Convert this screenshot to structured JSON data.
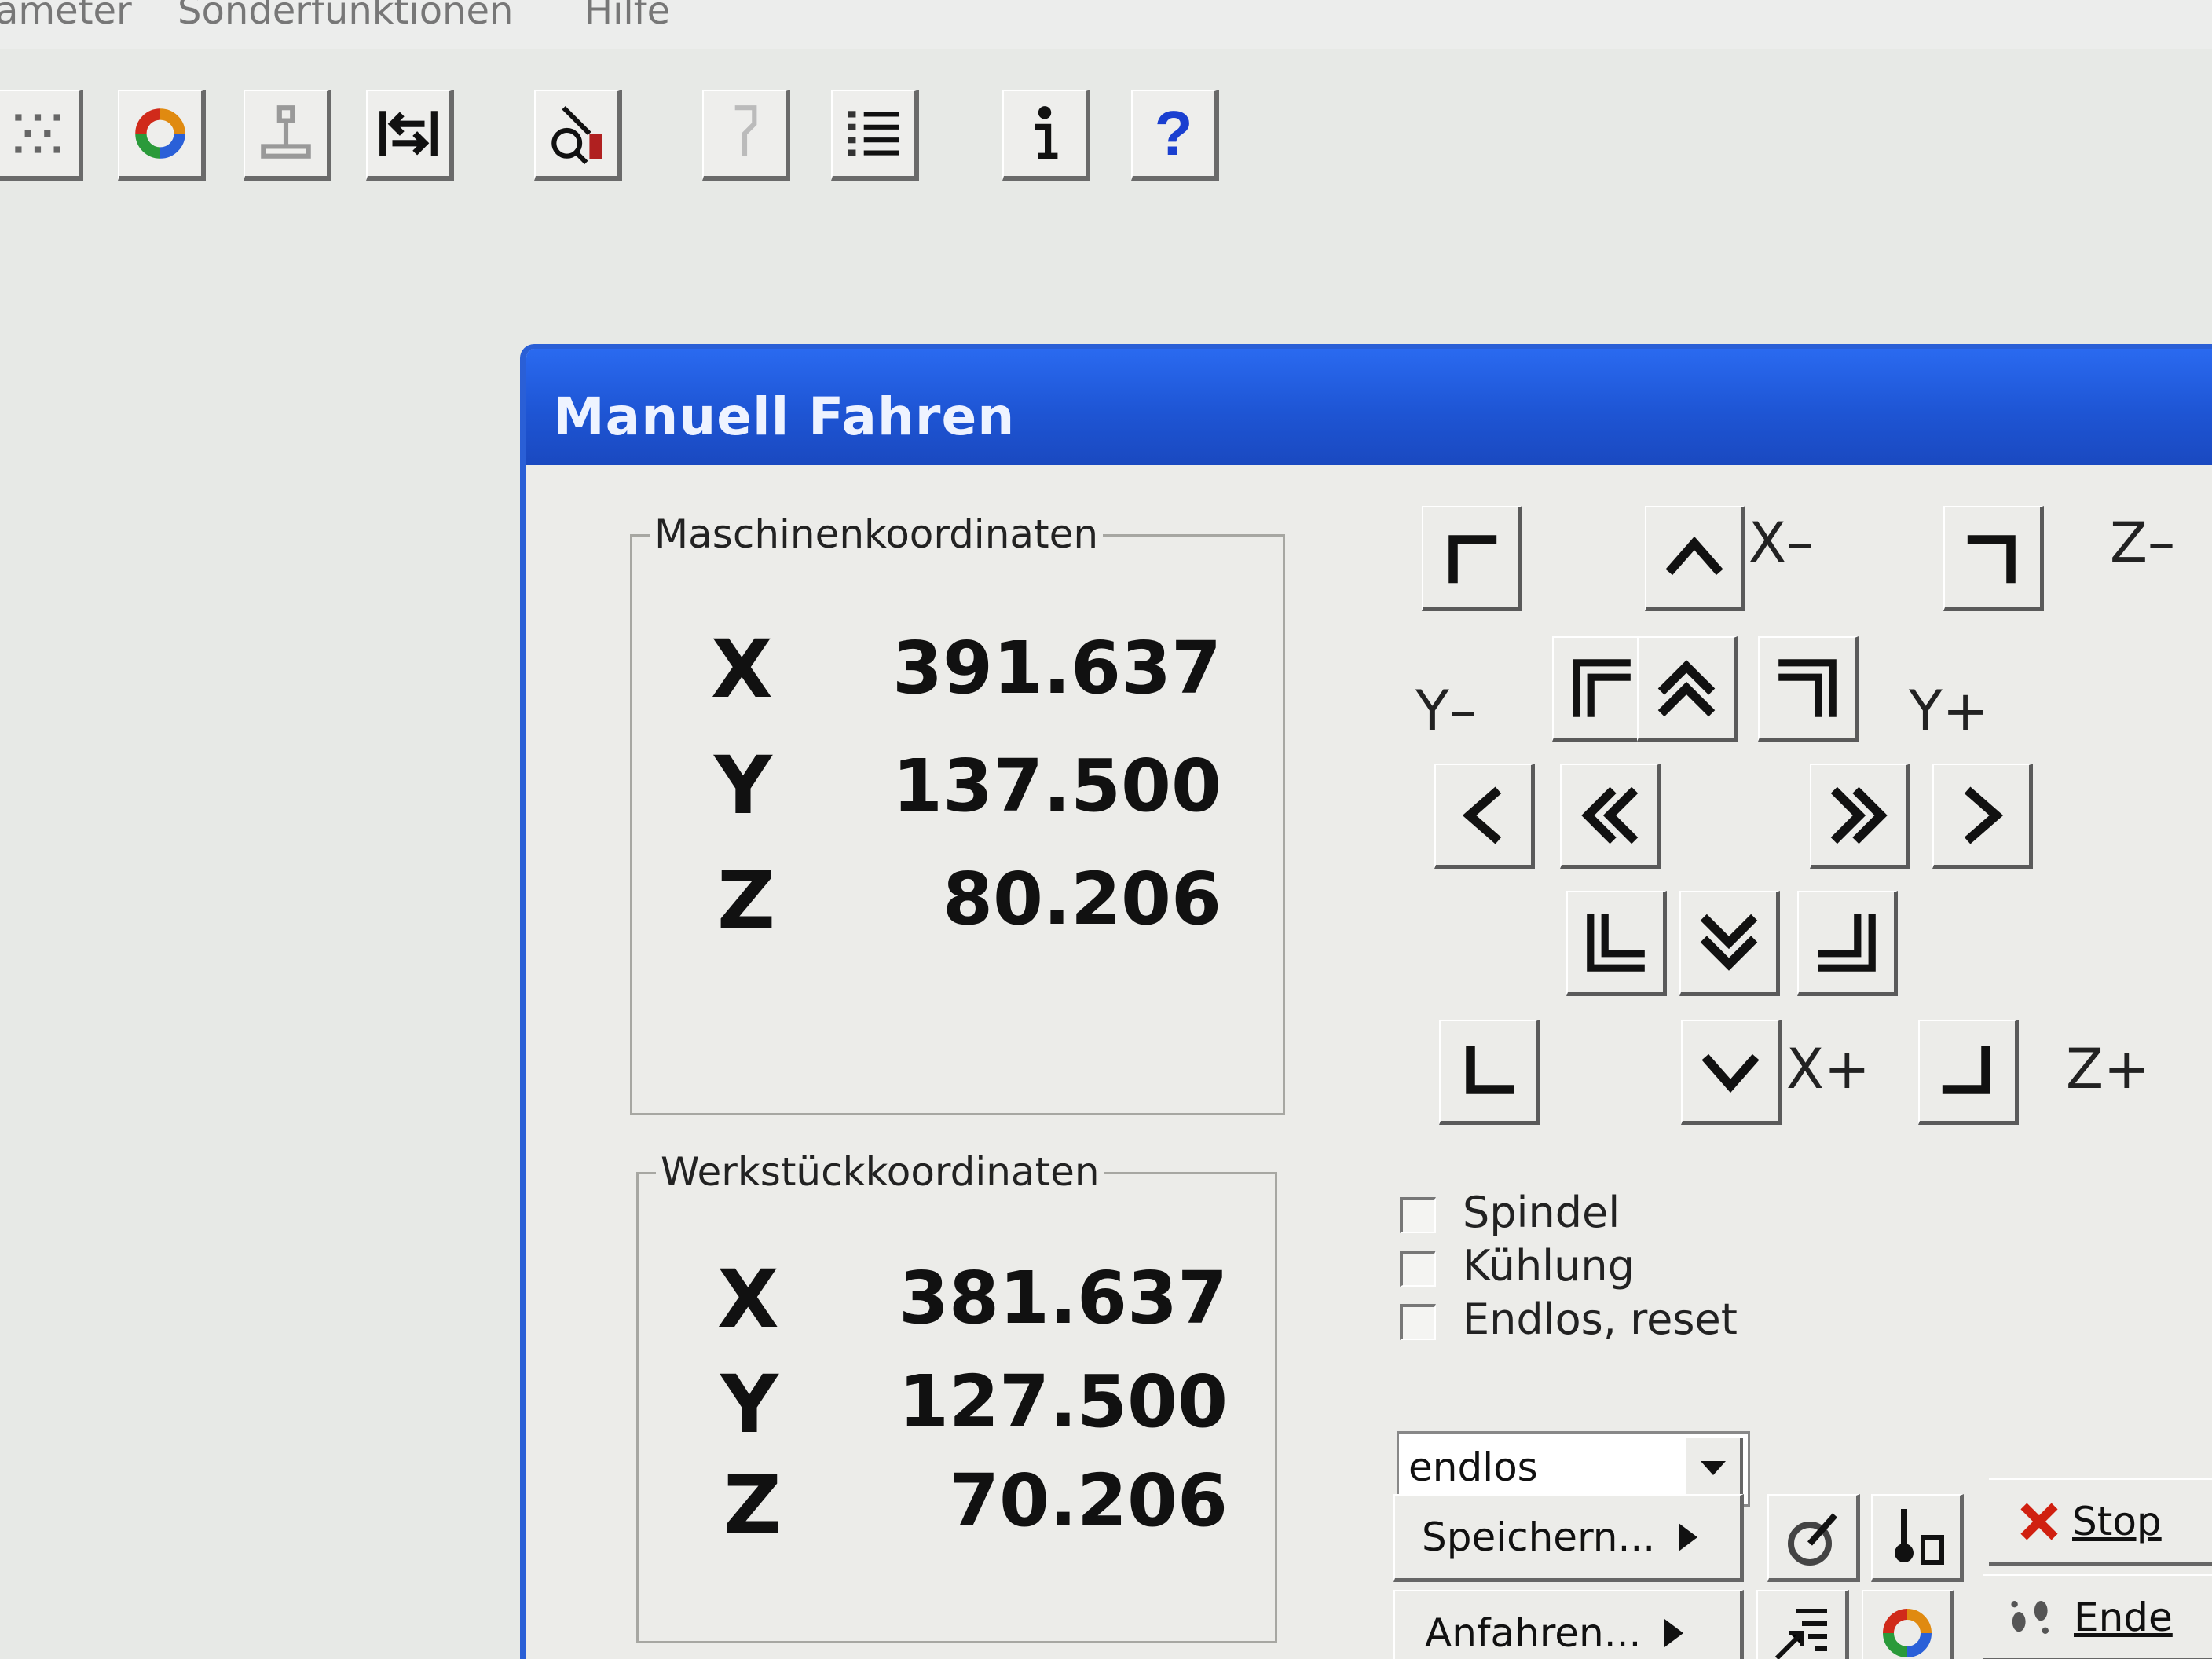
{
  "menu": {
    "items": [
      "ameter",
      "Sonderfunktionen",
      "Hilfe"
    ]
  },
  "toolbar": {
    "icons": [
      "grid-dots-icon",
      "refresh-cycle-icon",
      "joystick-icon",
      "jump-to-line-icon",
      "search-tool-icon",
      "disabled-tool-icon",
      "numbered-list-icon",
      "info-icon",
      "help-icon"
    ],
    "help_label": "?"
  },
  "dialog": {
    "title": "Manuell Fahren",
    "machine": {
      "label": "Maschinenkoordinaten",
      "x_label": "X",
      "x": "391.637",
      "y_label": "Y",
      "y": "137.500",
      "z_label": "Z",
      "z": "80.206"
    },
    "workpiece": {
      "label": "Werkstückkoordinaten",
      "x_label": "X",
      "x": "381.637",
      "y_label": "Y",
      "y": "127.500",
      "z_label": "Z",
      "z": "70.206"
    },
    "axis_labels": {
      "x_minus": "X–",
      "x_plus": "X+",
      "y_minus": "Y–",
      "y_plus": "Y+",
      "z_minus": "Z–",
      "z_plus": "Z+"
    },
    "options": {
      "spindel": "Spindel",
      "kuehlung": "Kühlung",
      "endlos_reset": "Endlos, reset"
    },
    "mode_select": {
      "value": "endlos"
    },
    "buttons": {
      "speichern": "Speichern...",
      "anfahren": "Anfahren...",
      "stop": "Stop",
      "ende": "Ende"
    },
    "colors": {
      "title_bar": "#1e55d4",
      "stop_icon": "#d02010"
    }
  }
}
